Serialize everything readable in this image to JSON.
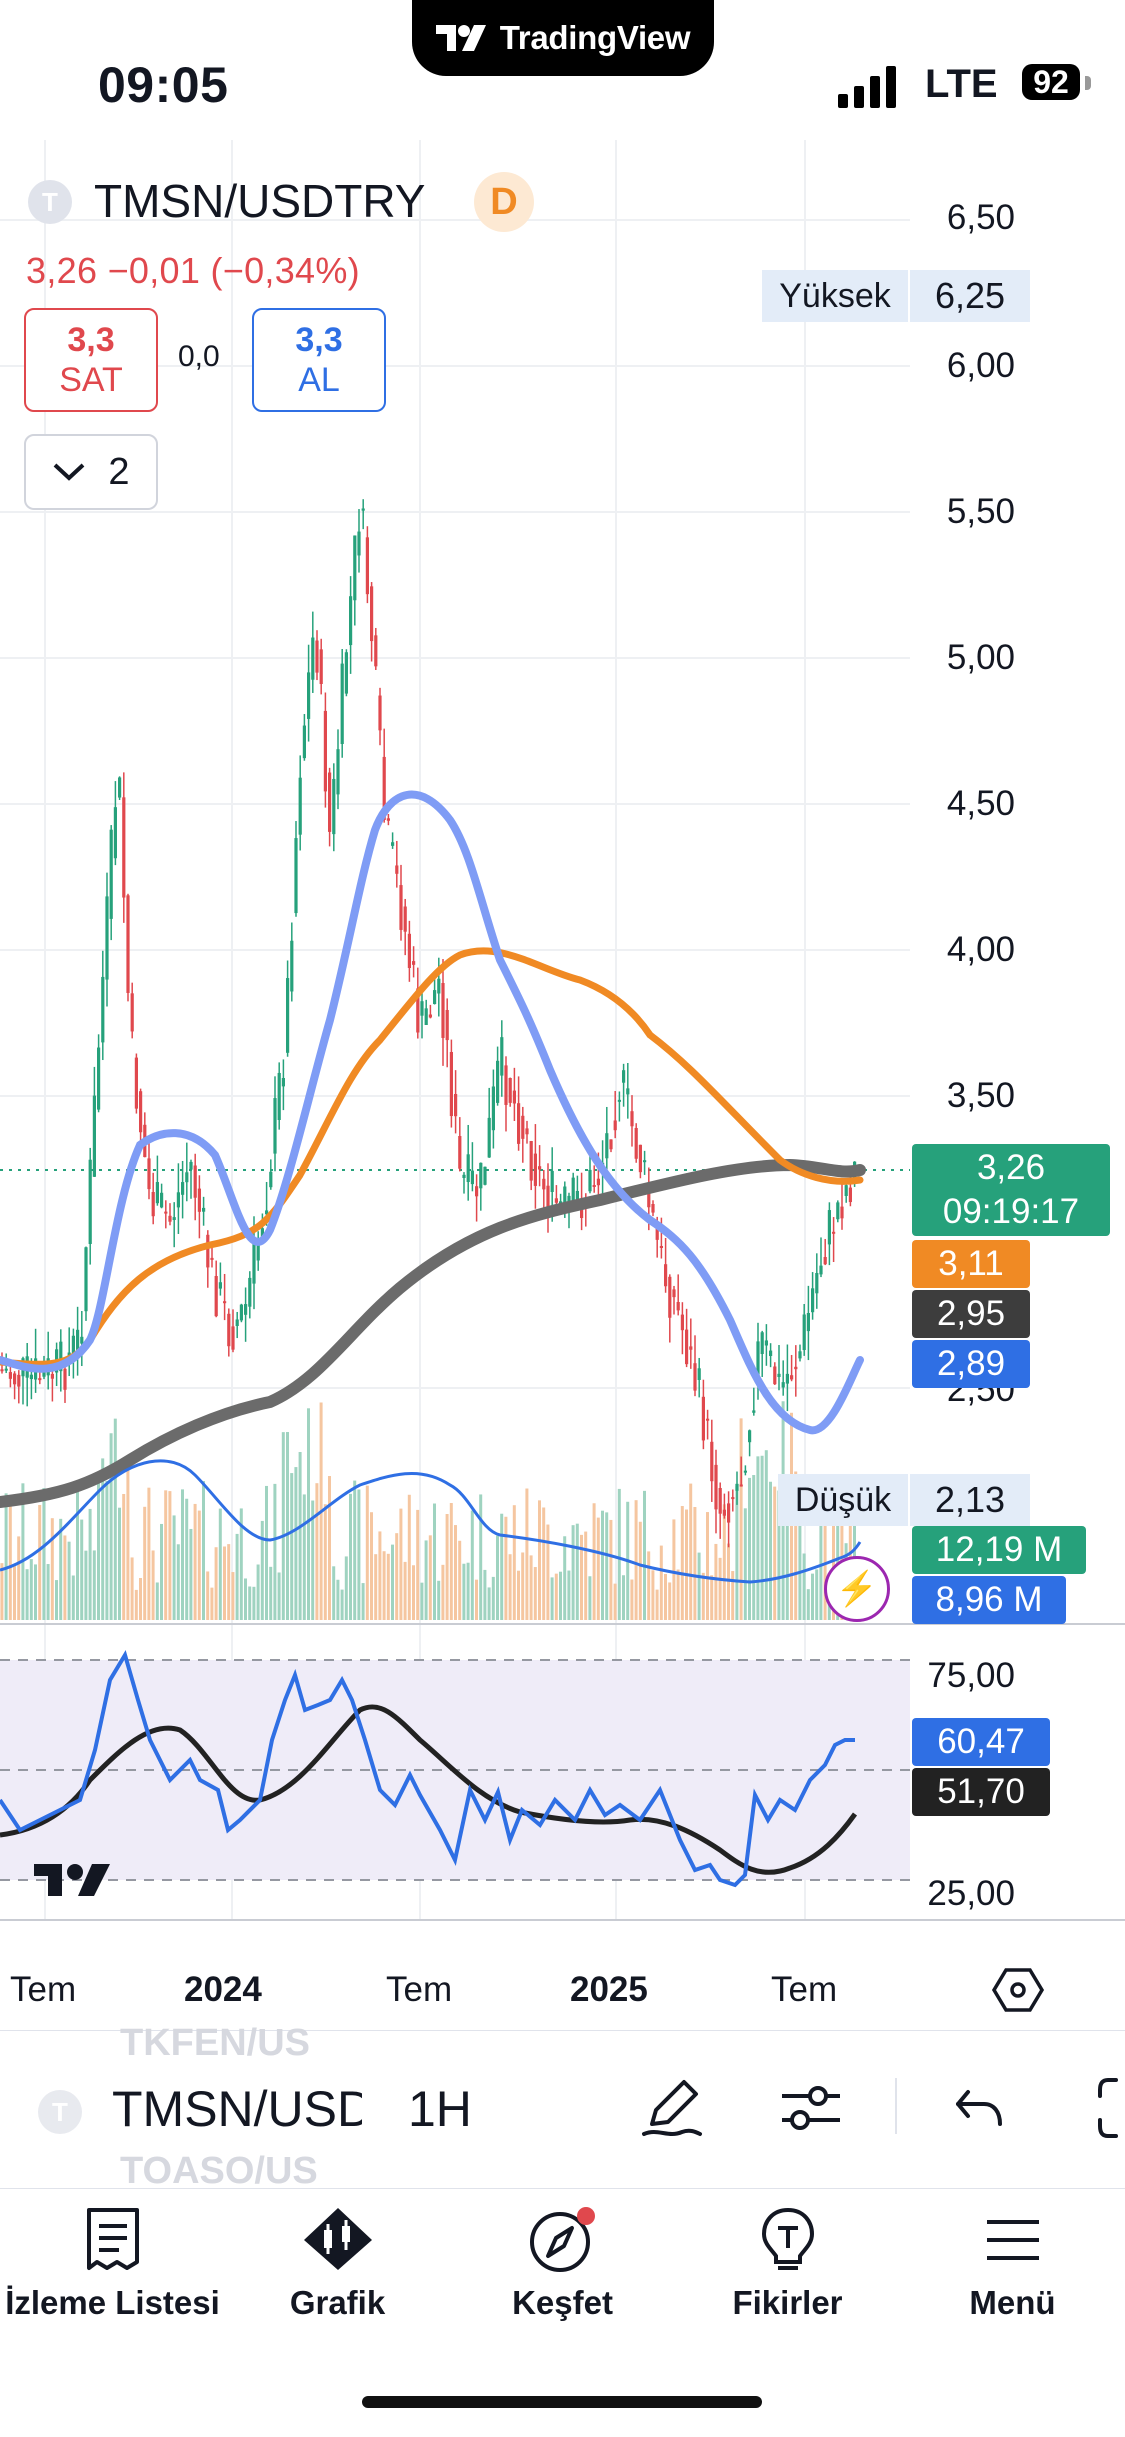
{
  "status_bar": {
    "app_name": "TradingView",
    "time": "09:05",
    "network": "LTE",
    "battery": "92"
  },
  "header": {
    "symbol": "TMSN/USDTRY",
    "symbol_icon_letter": "T",
    "interval_badge": "D",
    "price_line": "3,26  −0,01 (−0,34%)",
    "sell": {
      "price": "3,3",
      "label": "SAT"
    },
    "buy": {
      "price": "3,3",
      "label": "AL"
    },
    "spread": "0,0",
    "indicators_count": "2"
  },
  "price_axis": {
    "ticks": [
      "6,50",
      "6,00",
      "5,50",
      "5,00",
      "4,50",
      "4,00",
      "3,50"
    ],
    "high_label": "Yüksek",
    "high_value": "6,25",
    "low_label": "Düşük",
    "low_value": "2,13",
    "last_price": "3,26",
    "countdown": "09:19:17",
    "ma_labels": [
      {
        "value": "3,11",
        "color": "#f08a24"
      },
      {
        "value": "2,95",
        "color": "#3d3d3d"
      },
      {
        "value": "2,89",
        "color": "#2f6fe4"
      }
    ],
    "partial_tick": "2,50",
    "volume": {
      "value": "12,19 M",
      "color": "#26a17b"
    },
    "volume_ma": {
      "value": "8,96 M",
      "color": "#2f6fe4"
    }
  },
  "rsi_axis": {
    "ticks": [
      "75,00",
      "25,00"
    ],
    "rsi_value": "60,47",
    "rsi_ma_value": "51,70"
  },
  "time_axis": {
    "labels": [
      "Tem",
      "2024",
      "Tem",
      "2025",
      "Tem"
    ]
  },
  "colors": {
    "up": "#26a17b",
    "down": "#e0484d",
    "ma_fast": "#7f9cf5",
    "ma_mid": "#f08a24",
    "ma_slow": "#6b6b6b",
    "rsi": "#2f6fe4"
  },
  "toolbar": {
    "symbol": "TMSN/USD",
    "interval": "1H",
    "ghost_above": "TKFEN/US",
    "ghost_below": "TOASO/US",
    "icons": [
      "pencil-icon",
      "sliders-icon",
      "undo-icon",
      "fullscreen-icon"
    ]
  },
  "bottom_nav": {
    "items": [
      {
        "label": "İzleme Listesi",
        "icon": "watchlist-icon"
      },
      {
        "label": "Grafik",
        "icon": "chart-icon"
      },
      {
        "label": "Keşfet",
        "icon": "compass-icon"
      },
      {
        "label": "Fikirler",
        "icon": "ideas-icon"
      },
      {
        "label": "Menü",
        "icon": "menu-icon"
      }
    ]
  }
}
